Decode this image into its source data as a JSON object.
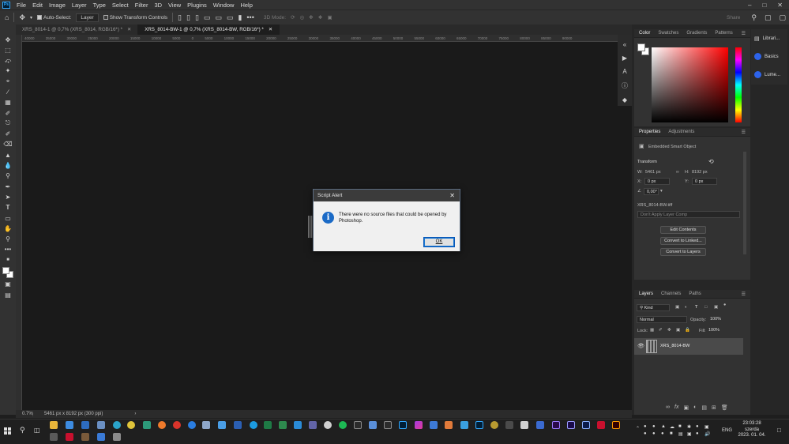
{
  "app": {
    "logo": "Ps"
  },
  "menu": [
    "File",
    "Edit",
    "Image",
    "Layer",
    "Type",
    "Select",
    "Filter",
    "3D",
    "View",
    "Plugins",
    "Window",
    "Help"
  ],
  "options_bar": {
    "auto_select_label": "Auto-Select:",
    "auto_select_value": "Layer",
    "show_transform_label": "Show Transform Controls",
    "mode_3d_label": "3D Mode:",
    "share_label": "Share"
  },
  "tabs": [
    {
      "label": "XRS_8014-1 @ 0,7% (XRS_8014, RGB/16*) *",
      "active": false
    },
    {
      "label": "XRS_8014-BW-1 @ 0,7% (XRS_8014-BW, RGB/16*) *",
      "active": true
    }
  ],
  "ruler_ticks": "40000 35000 30000 25000 20000 15000 10000 5000 0 5000 10000 15000 20000 25000 30000 35000 40000 45000 50000 55000 60000 65000 70000 75000 80000 85000 90000",
  "status_bar": {
    "zoom": "0.7%",
    "info": "5461 px x 8192 px (300 ppi)"
  },
  "color_panel": {
    "tabs": [
      "Color",
      "Swatches",
      "Gradients",
      "Patterns"
    ]
  },
  "libraries": {
    "items": [
      "Librari...",
      "Basics",
      "Lume..."
    ]
  },
  "properties_panel": {
    "tabs": [
      "Properties",
      "Adjustments"
    ],
    "object_type": "Embedded Smart Object",
    "transform_label": "Transform",
    "w_label": "W:",
    "w_value": "5461 px",
    "h_label": "H:",
    "h_value": "8192 px",
    "x_label": "X:",
    "x_value": "0 px",
    "y_label": "Y:",
    "y_value": "0 px",
    "angle_value": "0,00°",
    "filename": "XRS_8014-BW.tiff",
    "layer_comp": "Don't Apply Layer Comp",
    "buttons": [
      "Edit Contents",
      "Convert to Linked...",
      "Convert to Layers"
    ]
  },
  "layers_panel": {
    "tabs": [
      "Layers",
      "Channels",
      "Paths"
    ],
    "kind_label": "Kind",
    "blend_mode": "Normal",
    "opacity_label": "Opacity:",
    "opacity_value": "100%",
    "lock_label": "Lock:",
    "fill_label": "Fill:",
    "fill_value": "100%",
    "layer_name": "XRS_8014-BW"
  },
  "dialog": {
    "title": "Script Alert",
    "message": "There were no source files that could be opened by Photoshop.",
    "ok_label": "OK"
  },
  "taskbar": {
    "lang": "ENG",
    "time": "23:03:28",
    "day": "szerda",
    "date": "2023. 01. 04."
  },
  "colors": {
    "accent": "#31a8ff",
    "dialog_icon": "#1b6ac6",
    "ui_bg": "#323232"
  }
}
